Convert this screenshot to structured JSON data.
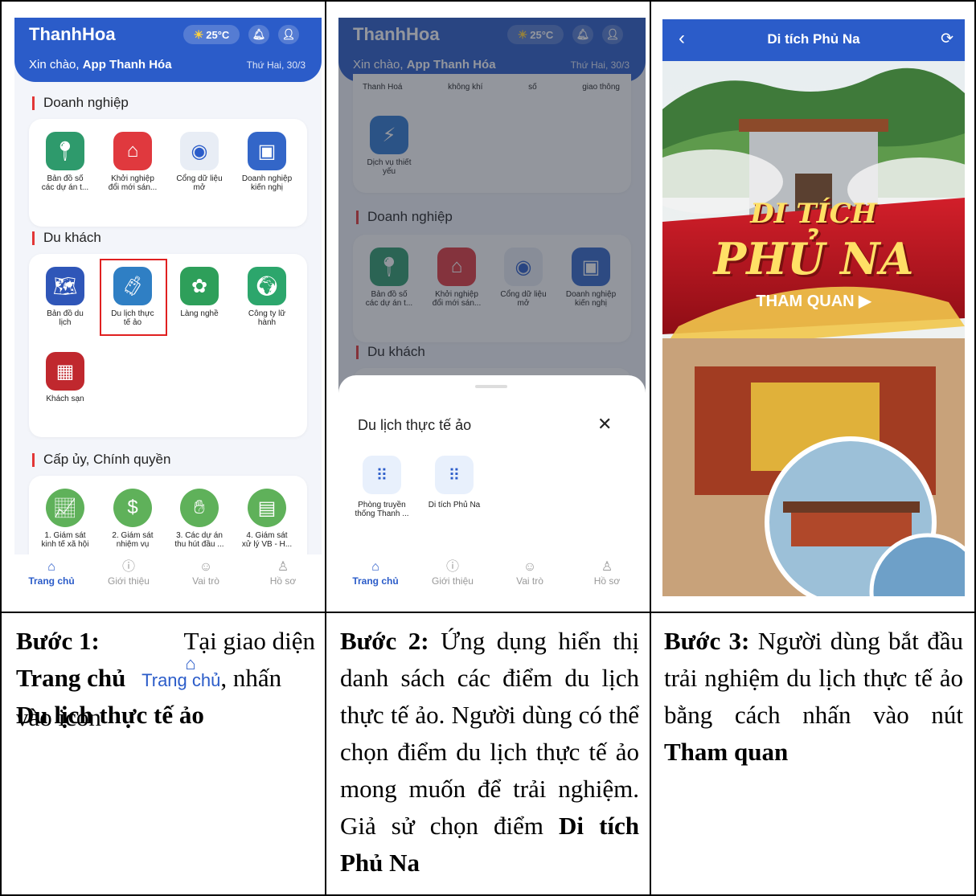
{
  "screen1": {
    "brand": "ThanhHoa",
    "weather": "25°C",
    "greet_prefix": "Xin chào,",
    "greet_name": "App Thanh Hóa",
    "date": "Thứ Hai, 30/3",
    "sec_business": "Doanh nghiệp",
    "business_apps": [
      {
        "l1": "Bản đồ số",
        "l2": "các dự án t...",
        "color": "#2e9a6c"
      },
      {
        "l1": "Khởi nghiệp",
        "l2": "đổi mới sán...",
        "color": "#e0393e"
      },
      {
        "l1": "Cổng dữ liệu",
        "l2": "mở",
        "color": "#e8edf5"
      },
      {
        "l1": "Doanh nghiệp",
        "l2": "kiến nghị",
        "color": "#3366c8"
      }
    ],
    "sec_tourist": "Du khách",
    "tourist_apps": [
      {
        "l1": "Bản đồ du",
        "l2": "lịch",
        "color": "#2f56b8"
      },
      {
        "l1": "Du lịch thực",
        "l2": "tế ảo",
        "color": "#2f7fc4"
      },
      {
        "l1": "Làng nghề",
        "l2": "",
        "color": "#2e9f5a"
      },
      {
        "l1": "Công ty lữ",
        "l2": "hành",
        "color": "#2ca66c"
      },
      {
        "l1": "Khách sạn",
        "l2": "",
        "color": "#c0282e"
      }
    ],
    "sec_gov": "Cấp ủy, Chính quyền",
    "gov_apps": [
      {
        "l1": "1. Giám sát",
        "l2": "kinh tế xã hội",
        "color": "#5fb15a"
      },
      {
        "l1": "2. Giám sát",
        "l2": "nhiệm vụ",
        "color": "#5fb15a"
      },
      {
        "l1": "3. Các dự án",
        "l2": "thu hút đầu ...",
        "color": "#5fb15a"
      },
      {
        "l1": "4. Giám sát",
        "l2": "xử lý VB - H...",
        "color": "#5fb15a"
      }
    ]
  },
  "screen2": {
    "top_labels": [
      "Thanh Hoá",
      "không khí",
      "số",
      "giao thông"
    ],
    "service": {
      "l1": "Dịch vụ thiết",
      "l2": "yếu"
    },
    "sheet_title": "Du lịch thực tế ảo",
    "sheet_items": [
      {
        "l1": "Phòng truyền",
        "l2": "thống Thanh ..."
      },
      {
        "l1": "Di tích Phủ Na",
        "l2": ""
      }
    ]
  },
  "nav": [
    "Trang chủ",
    "Giới thiệu",
    "Vai trò",
    "Hồ sơ"
  ],
  "screen3": {
    "title": "Di tích Phủ Na",
    "banner_l1": "DI TÍCH",
    "banner_l2": "PHỦ NA",
    "cta": "THAM QUAN ▶"
  },
  "captions": {
    "c1_b1": "Bước 1:",
    "c1_t1": " Tại giao diện",
    "c1_icon_label": "Trang chủ",
    "c1_b2": "Trang chủ",
    "c1_t2": ", nhấn vào icon ",
    "c1_b3": "Du lịch thực tế ảo",
    "c2_b1": "Bước 2:",
    "c2_t1": " Ứng dụng hiển thị danh sách các điểm du lịch thực tế ảo. Người dùng có thể chọn điểm du lịch thực tế ảo mong muốn để trải nghiệm. Giả sử chọn điểm ",
    "c2_b2": "Di tích Phủ Na",
    "c3_b1": "Bước 3:",
    "c3_t1": " Người dùng bắt đầu trải nghiệm du lịch thực tế ảo bằng cách nhấn vào nút ",
    "c3_b2": "Tham quan"
  }
}
